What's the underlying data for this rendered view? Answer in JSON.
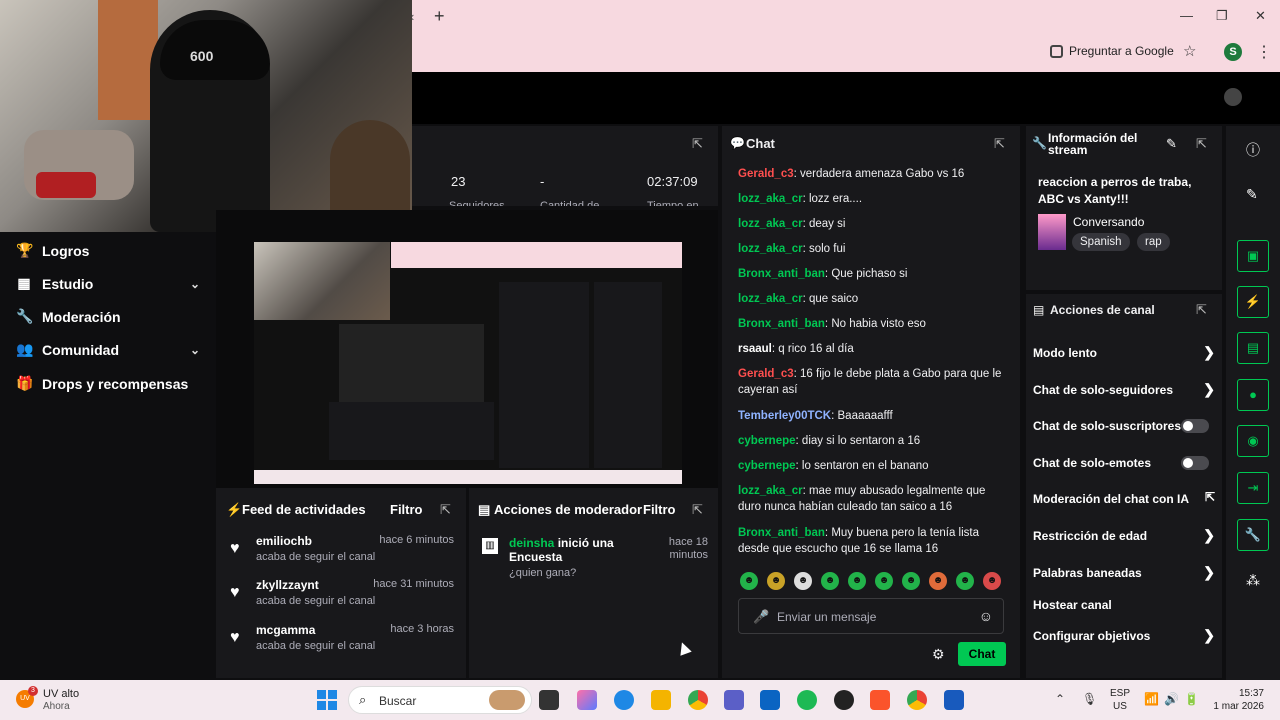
{
  "browser": {
    "ask_google": "Preguntar a Google",
    "profile_initial": "S"
  },
  "webcam": {
    "hat_text": "600"
  },
  "left_nav": {
    "items": [
      {
        "label": "Logros",
        "icon": "trophy-icon"
      },
      {
        "label": "Estudio",
        "icon": "film-icon",
        "expandable": true
      },
      {
        "label": "Moderación",
        "icon": "wrench-icon"
      },
      {
        "label": "Comunidad",
        "icon": "people-icon",
        "expandable": true
      },
      {
        "label": "Drops y recompensas",
        "icon": "gift-icon"
      }
    ]
  },
  "stats": {
    "values": [
      "23",
      "-",
      "02:37:09"
    ],
    "labels": [
      "Seguidores",
      "Cantidad de",
      "Tiempo en"
    ]
  },
  "activity_feed": {
    "title": "Feed de actividades",
    "filter": "Filtro",
    "items": [
      {
        "user": "emiliochb",
        "time": "hace 6 minutos",
        "action": "acaba de seguir el canal"
      },
      {
        "user": "zkyllzzaynt",
        "time": "hace 31 minutos",
        "action": "acaba de seguir el canal"
      },
      {
        "user": "mcgamma",
        "time": "hace 3 horas",
        "action": "acaba de seguir el canal"
      }
    ]
  },
  "mod_actions": {
    "title": "Acciones de moderador",
    "filter": "Filtro",
    "items": [
      {
        "user": "deinsha",
        "action": "inició una Encuesta",
        "time": "hace 18 minutos",
        "detail": "¿quien gana?"
      }
    ]
  },
  "chat": {
    "title": "Chat",
    "messages": [
      {
        "user": "Gerald_c3",
        "color": "#ff4f4f",
        "text": "verdadera amenaza Gabo vs 16"
      },
      {
        "user": "lozz_aka_cr",
        "color": "#00c853",
        "text": "lozz era...."
      },
      {
        "user": "lozz_aka_cr",
        "color": "#00c853",
        "text": "deay si"
      },
      {
        "user": "lozz_aka_cr",
        "color": "#00c853",
        "text": "solo fui"
      },
      {
        "user": "Bronx_anti_ban",
        "color": "#00c853",
        "text": "Que pichaso si"
      },
      {
        "user": "lozz_aka_cr",
        "color": "#00c853",
        "text": "que saico"
      },
      {
        "user": "Bronx_anti_ban",
        "color": "#00c853",
        "text": "No habia visto eso"
      },
      {
        "user": "rsaaul",
        "color": "#ffffff",
        "text": "q rico 16 al día"
      },
      {
        "user": "Gerald_c3",
        "color": "#ff4f4f",
        "text": "16 fijo le debe plata a Gabo para que le cayeran así"
      },
      {
        "user": "Temberley00TCK",
        "color": "#8fb3ff",
        "text": "Baaaaaafff"
      },
      {
        "user": "cybernepe",
        "color": "#00c853",
        "text": "diay si lo sentaron a 16"
      },
      {
        "user": "cybernepe",
        "color": "#00c853",
        "text": "lo sentaron en el banano"
      },
      {
        "user": "lozz_aka_cr",
        "color": "#00c853",
        "text": "mae muy abusado legalmente que duro nunca habían culeado tan saico a 16"
      },
      {
        "user": "Bronx_anti_ban",
        "color": "#00c853",
        "text": "Muy buena pero la tenía lista desde que escucho que 16 se llama 16"
      }
    ],
    "input_placeholder": "Enviar un mensaje",
    "send_label": "Chat"
  },
  "stream_info": {
    "header": "Información del stream",
    "title": "reaccion a perros de traba, ABC vs Xanty!!!",
    "category": "Conversando",
    "tags": [
      "Spanish",
      "rap"
    ]
  },
  "channel_actions": {
    "header": "Acciones de canal",
    "items": [
      {
        "label": "Modo lento",
        "control": "arrow"
      },
      {
        "label": "Chat de solo-seguidores",
        "control": "arrow"
      },
      {
        "label": "Chat de solo-suscriptores",
        "control": "toggle",
        "on": false
      },
      {
        "label": "Chat de solo-emotes",
        "control": "toggle",
        "on": false
      },
      {
        "label": "Moderación del chat con IA",
        "control": "external"
      },
      {
        "label": "Restricción de edad",
        "control": "arrow"
      },
      {
        "label": "Palabras baneadas",
        "control": "arrow"
      },
      {
        "label": "Hostear canal",
        "control": "none"
      },
      {
        "label": "Configurar objetivos",
        "control": "arrow"
      }
    ]
  },
  "taskbar": {
    "weather_line1": "UV alto",
    "weather_line2": "Ahora",
    "weather_badge": "3",
    "search_label": "Buscar",
    "lang_line1": "ESP",
    "lang_line2": "US",
    "time": "15:37",
    "date": "1 mar 2026"
  },
  "colors": {
    "accent": "#00c853",
    "panel": "#18181b",
    "background": "#0e0e10"
  }
}
